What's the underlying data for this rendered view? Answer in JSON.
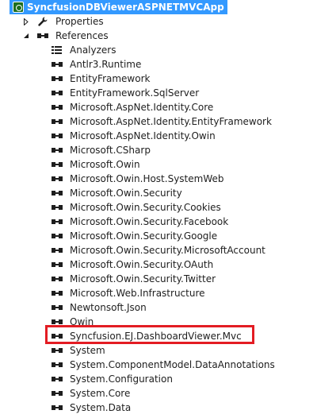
{
  "project": {
    "title": "SyncfusionDBViewerASPNETMVCApp",
    "icon": "web-project-icon"
  },
  "tree": {
    "properties": {
      "label": "Properties",
      "icon": "wrench-icon",
      "expanded": false
    },
    "references": {
      "label": "References",
      "icon": "reference-icon",
      "expanded": true,
      "items": [
        {
          "label": "Analyzers",
          "icon": "analyzers-icon"
        },
        {
          "label": "Antlr3.Runtime",
          "icon": "reference-icon"
        },
        {
          "label": "EntityFramework",
          "icon": "reference-icon"
        },
        {
          "label": "EntityFramework.SqlServer",
          "icon": "reference-icon"
        },
        {
          "label": "Microsoft.AspNet.Identity.Core",
          "icon": "reference-icon"
        },
        {
          "label": "Microsoft.AspNet.Identity.EntityFramework",
          "icon": "reference-icon"
        },
        {
          "label": "Microsoft.AspNet.Identity.Owin",
          "icon": "reference-icon"
        },
        {
          "label": "Microsoft.CSharp",
          "icon": "reference-icon"
        },
        {
          "label": "Microsoft.Owin",
          "icon": "reference-icon"
        },
        {
          "label": "Microsoft.Owin.Host.SystemWeb",
          "icon": "reference-icon"
        },
        {
          "label": "Microsoft.Owin.Security",
          "icon": "reference-icon"
        },
        {
          "label": "Microsoft.Owin.Security.Cookies",
          "icon": "reference-icon"
        },
        {
          "label": "Microsoft.Owin.Security.Facebook",
          "icon": "reference-icon"
        },
        {
          "label": "Microsoft.Owin.Security.Google",
          "icon": "reference-icon"
        },
        {
          "label": "Microsoft.Owin.Security.MicrosoftAccount",
          "icon": "reference-icon"
        },
        {
          "label": "Microsoft.Owin.Security.OAuth",
          "icon": "reference-icon"
        },
        {
          "label": "Microsoft.Owin.Security.Twitter",
          "icon": "reference-icon"
        },
        {
          "label": "Microsoft.Web.Infrastructure",
          "icon": "reference-icon"
        },
        {
          "label": "Newtonsoft.Json",
          "icon": "reference-icon"
        },
        {
          "label": "Owin",
          "icon": "reference-icon"
        },
        {
          "label": "Syncfusion.EJ.DashboardViewer.Mvc",
          "icon": "reference-icon",
          "highlighted": true
        },
        {
          "label": "System",
          "icon": "reference-icon"
        },
        {
          "label": "System.ComponentModel.DataAnnotations",
          "icon": "reference-icon"
        },
        {
          "label": "System.Configuration",
          "icon": "reference-icon"
        },
        {
          "label": "System.Core",
          "icon": "reference-icon"
        },
        {
          "label": "System.Data",
          "icon": "reference-icon"
        }
      ]
    }
  },
  "colors": {
    "selection": "#3399ff",
    "highlight_box": "#e31c23",
    "text": "#1e1e1e"
  }
}
